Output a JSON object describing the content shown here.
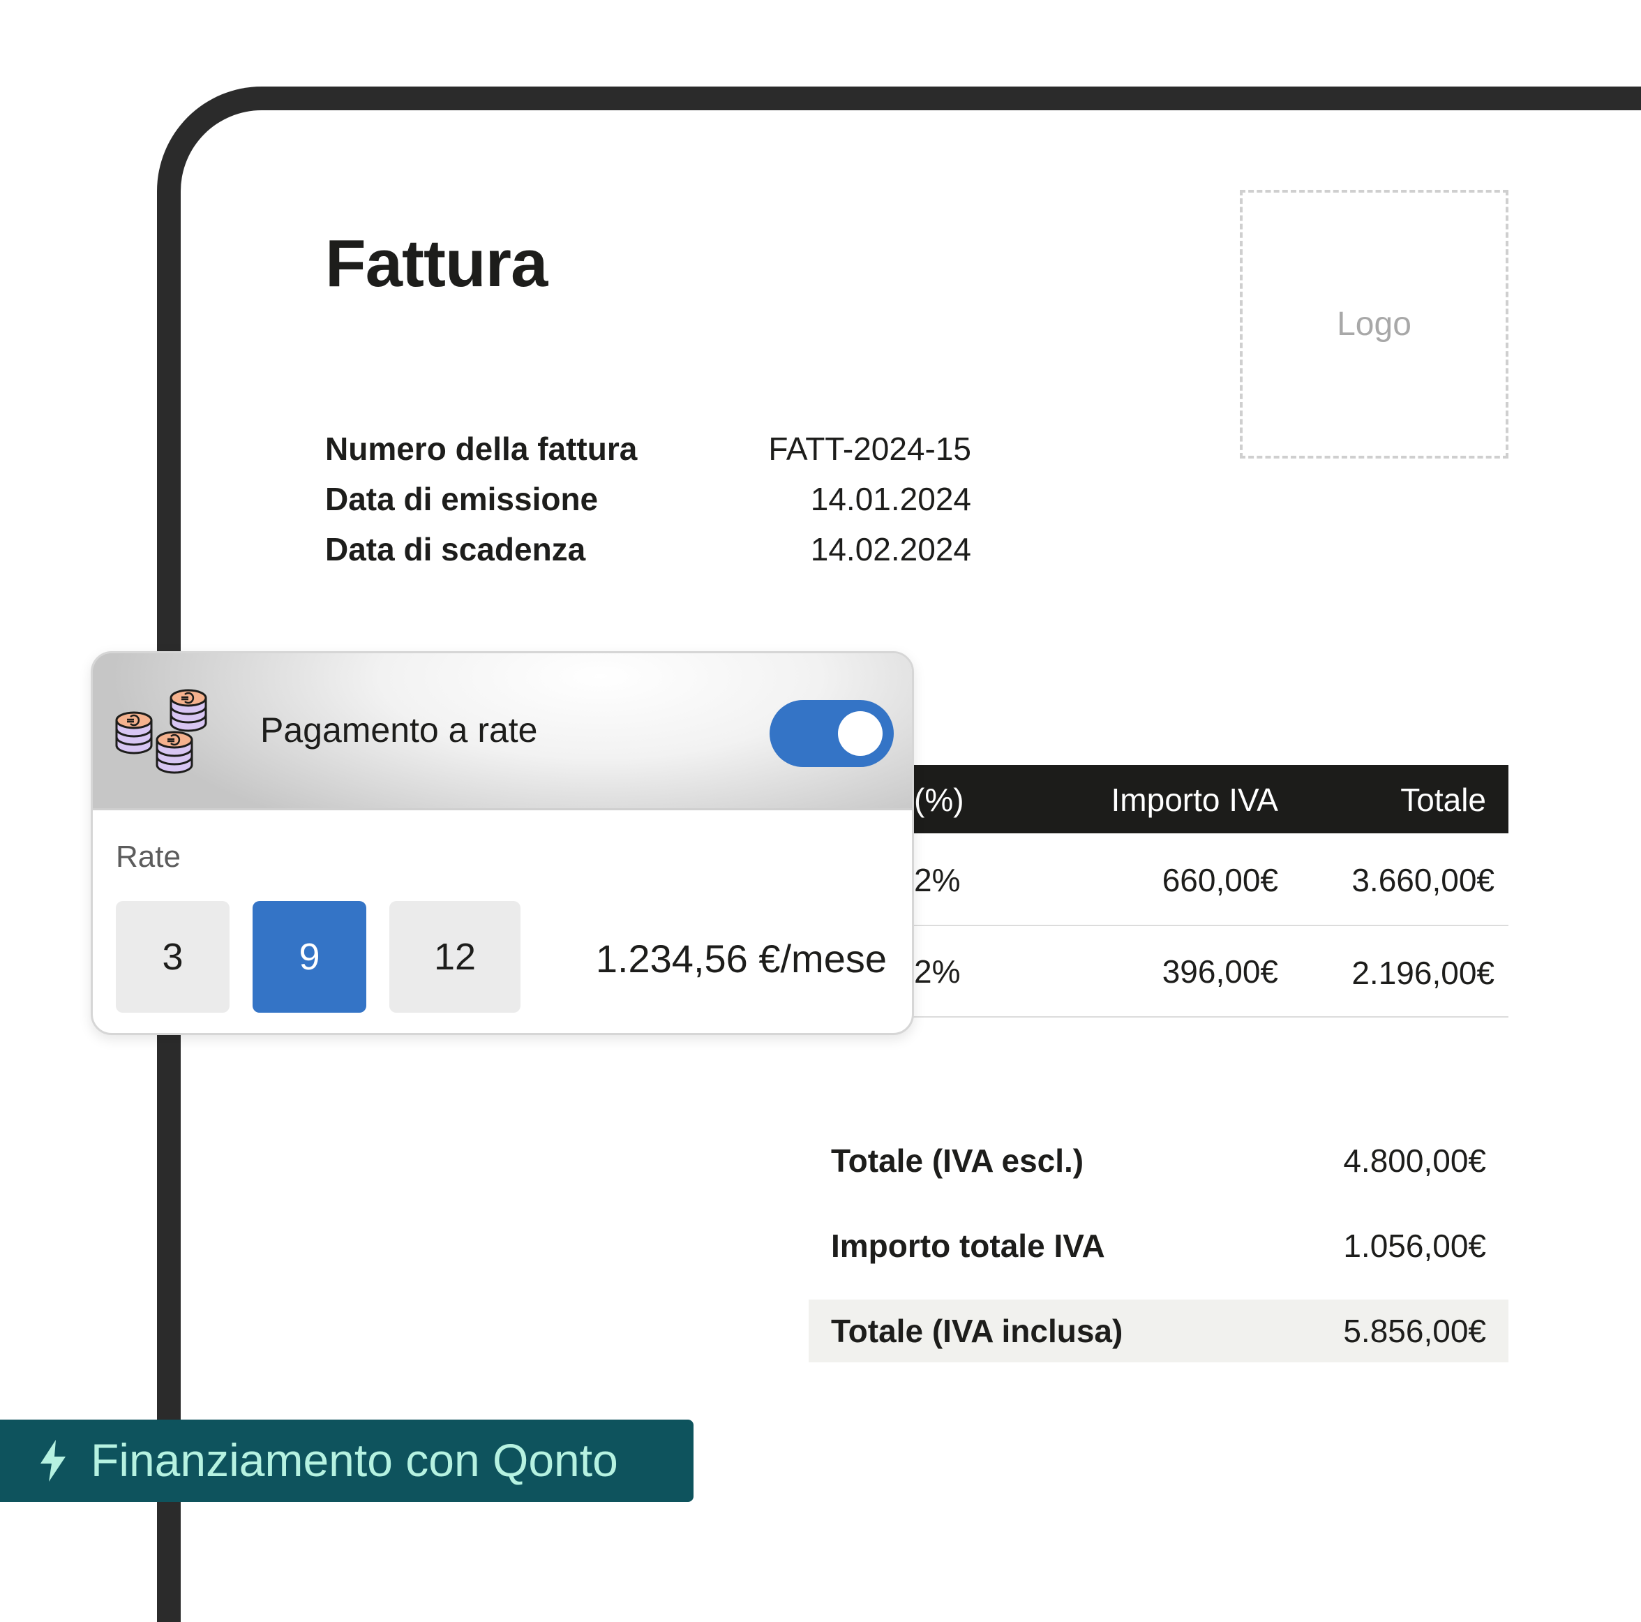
{
  "invoice": {
    "title": "Fattura",
    "logo_placeholder": "Logo",
    "meta": [
      {
        "label": "Numero della fattura",
        "value": "FATT-2024-15"
      },
      {
        "label": "Data di emissione",
        "value": "14.01.2024"
      },
      {
        "label": "Data di scadenza",
        "value": "14.02.2024"
      }
    ]
  },
  "table": {
    "headers": {
      "vat_rate": "(%)",
      "vat_amount": "Importo IVA",
      "total": "Totale"
    },
    "rows": [
      {
        "vat_rate": "2%",
        "vat_amount": "660,00€",
        "total": "3.660,00€"
      },
      {
        "vat_rate": "2%",
        "vat_amount": "396,00€",
        "total": "2.196,00€"
      }
    ]
  },
  "summary": [
    {
      "label": "Totale (IVA escl.)",
      "value": "4.800,00€"
    },
    {
      "label": "Importo totale IVA",
      "value": "1.056,00€"
    },
    {
      "label": "Totale (IVA inclusa)",
      "value": "5.856,00€"
    }
  ],
  "installments": {
    "title": "Pagamento a rate",
    "toggle_on": true,
    "rate_label": "Rate",
    "options": [
      "3",
      "9",
      "12"
    ],
    "selected_option": "9",
    "monthly_amount": "1.234,56 €/mese",
    "colors": {
      "accent": "#3474c6"
    }
  },
  "financing_badge": {
    "label": "Finanziamento con Qonto",
    "icon": "lightning-bolt-icon",
    "colors": {
      "background": "#0e535d",
      "text": "#b6f2e1"
    }
  }
}
